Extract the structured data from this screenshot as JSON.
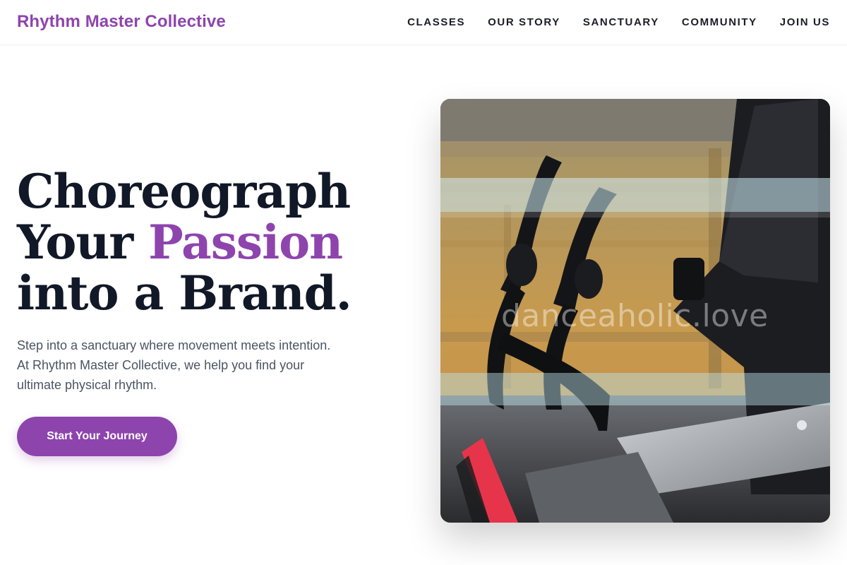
{
  "header": {
    "brand": "Rhythm Master Collective",
    "nav": [
      "CLASSES",
      "OUR STORY",
      "SANCTUARY",
      "COMMUNITY",
      "JOIN US"
    ]
  },
  "hero": {
    "headline_line1": "Choreograph",
    "headline_line2_prefix": "Your ",
    "headline_line2_accent": "Passion",
    "headline_line3": "into a Brand.",
    "lede": "Step into a sanctuary where movement meets intention. At Rhythm Master Collective, we help you find your ultimate physical rhythm.",
    "cta_label": "Start Your Journey",
    "image_watermark": "danceaholic.love"
  },
  "colors": {
    "accent": "#8e44ad",
    "heading": "#111827",
    "body_text": "#4b5563"
  }
}
